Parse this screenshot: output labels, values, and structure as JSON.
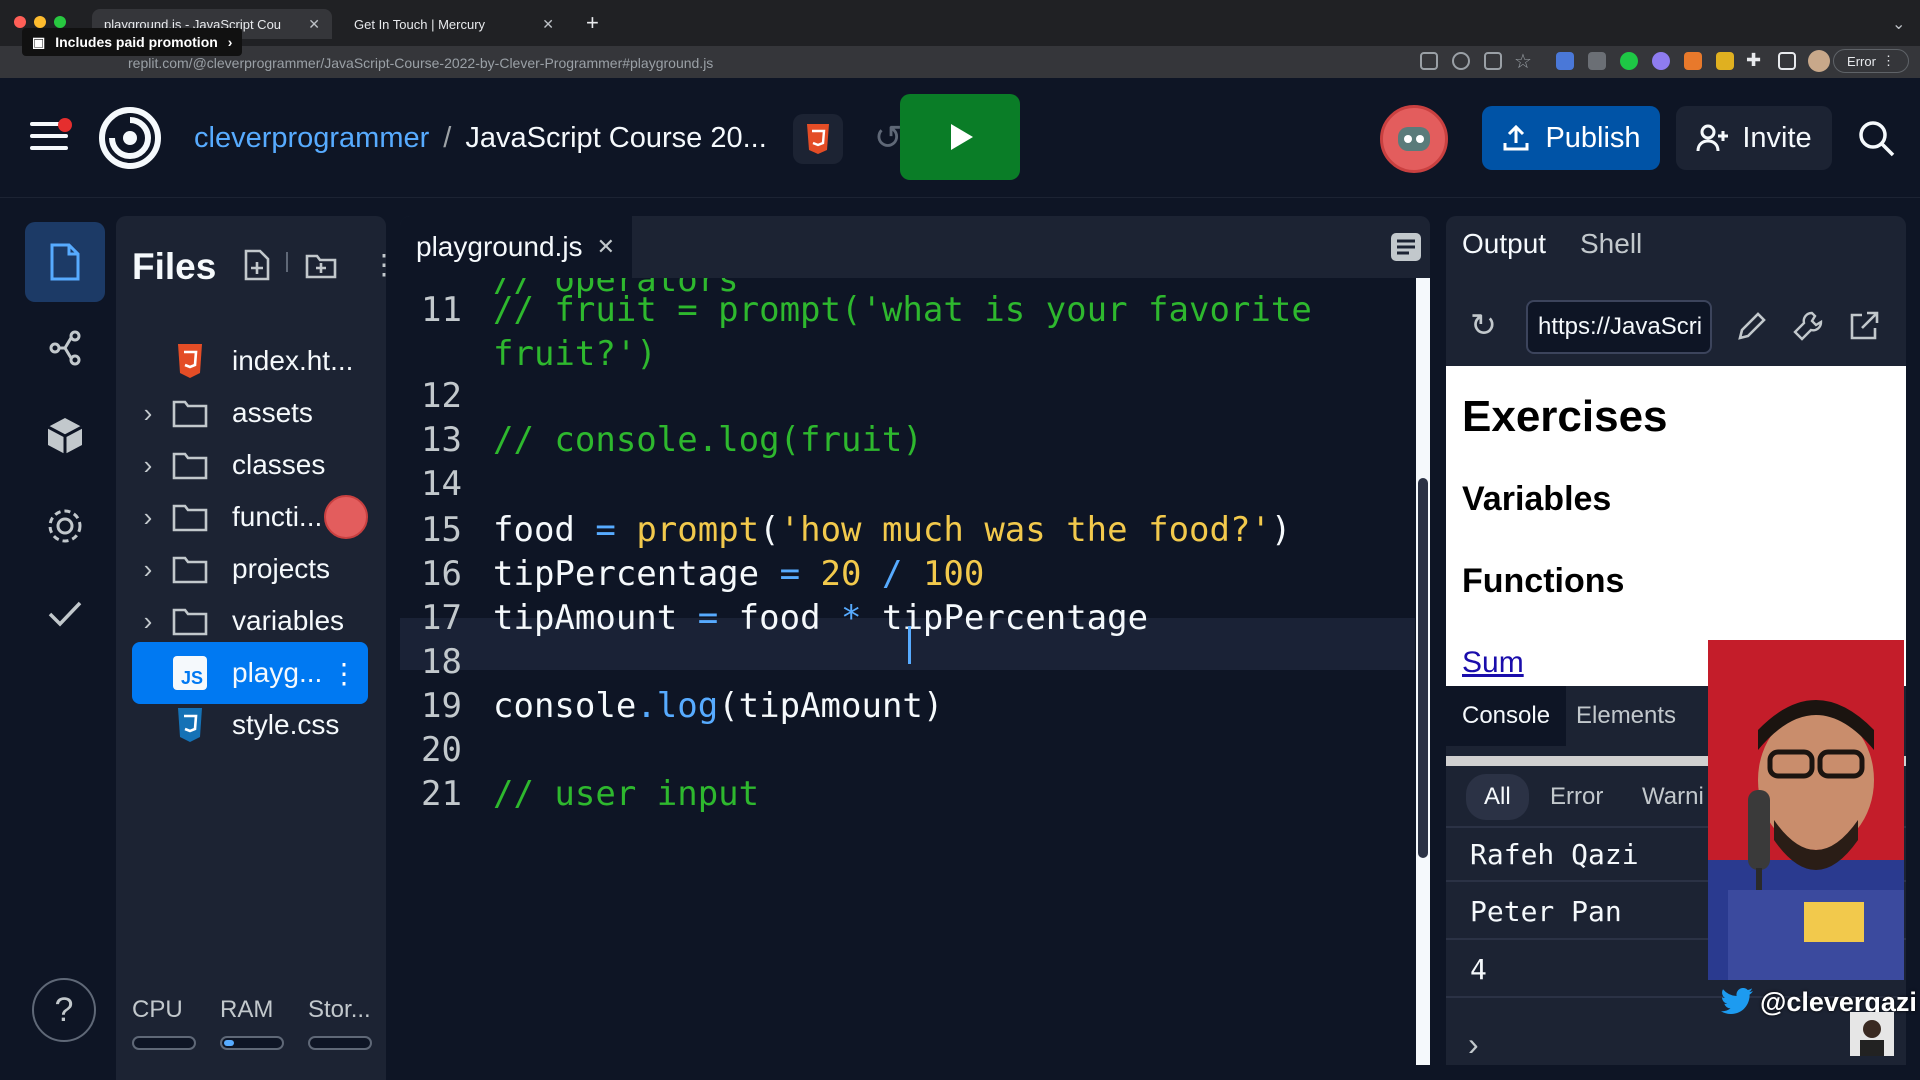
{
  "browser": {
    "tabs": [
      {
        "title": "playground.js - JavaScript Cou",
        "active": true
      },
      {
        "title": "Get In Touch | Mercury",
        "active": false
      }
    ],
    "new_tab": "+",
    "promo": "Includes paid promotion",
    "url": "replit.com/@cleverprogrammer/JavaScript-Course-2022-by-Clever-Programmer#playground.js",
    "error_pill": "Error"
  },
  "header": {
    "owner": "cleverprogrammer",
    "separator": "/",
    "project": "JavaScript Course 20...",
    "publish_label": "Publish",
    "invite_label": "Invite"
  },
  "files": {
    "title": "Files",
    "items": [
      {
        "name": "index.ht...",
        "type": "html",
        "folder": false
      },
      {
        "name": "assets",
        "type": "folder",
        "folder": true
      },
      {
        "name": "classes",
        "type": "folder",
        "folder": true
      },
      {
        "name": "functi...",
        "type": "folder",
        "folder": true
      },
      {
        "name": "projects",
        "type": "folder",
        "folder": true
      },
      {
        "name": "variables",
        "type": "folder",
        "folder": true
      },
      {
        "name": "playg...",
        "type": "js",
        "folder": false,
        "active": true
      },
      {
        "name": "style.css",
        "type": "css",
        "folder": false
      }
    ],
    "resources": {
      "cpu": "CPU",
      "ram": "RAM",
      "storage": "Stor..."
    }
  },
  "editor": {
    "tab": "playground.js",
    "lines": [
      {
        "n": "11",
        "tokens": [
          {
            "t": "// fruit = prompt('what is your favorite",
            "c": "cm"
          }
        ]
      },
      {
        "n": "",
        "tokens": [
          {
            "t": "fruit?')",
            "c": "cm"
          }
        ]
      },
      {
        "n": "12",
        "tokens": []
      },
      {
        "n": "13",
        "tokens": [
          {
            "t": "// console.log(fruit)",
            "c": "cm"
          }
        ]
      },
      {
        "n": "14",
        "tokens": []
      },
      {
        "n": "15",
        "tokens": [
          {
            "t": "food ",
            "c": "id"
          },
          {
            "t": "=",
            "c": "op"
          },
          {
            "t": " ",
            "c": "id"
          },
          {
            "t": "prompt",
            "c": "str"
          },
          {
            "t": "(",
            "c": "id"
          },
          {
            "t": "'how much was the food?'",
            "c": "str"
          },
          {
            "t": ")",
            "c": "id"
          }
        ]
      },
      {
        "n": "16",
        "tokens": [
          {
            "t": "tipPercentage ",
            "c": "id"
          },
          {
            "t": "=",
            "c": "op"
          },
          {
            "t": " ",
            "c": "id"
          },
          {
            "t": "20",
            "c": "num"
          },
          {
            "t": " ",
            "c": "id"
          },
          {
            "t": "/",
            "c": "op"
          },
          {
            "t": " ",
            "c": "id"
          },
          {
            "t": "100",
            "c": "num"
          }
        ]
      },
      {
        "n": "17",
        "tokens": [
          {
            "t": "tipAmount ",
            "c": "id"
          },
          {
            "t": "=",
            "c": "op"
          },
          {
            "t": " food ",
            "c": "id"
          },
          {
            "t": "*",
            "c": "op"
          },
          {
            "t": " tipPercentage",
            "c": "id"
          }
        ]
      },
      {
        "n": "18",
        "tokens": []
      },
      {
        "n": "19",
        "tokens": [
          {
            "t": "console",
            "c": "id"
          },
          {
            "t": ".",
            "c": "op"
          },
          {
            "t": "log",
            "c": "op"
          },
          {
            "t": "(tipAmount)",
            "c": "id"
          }
        ]
      },
      {
        "n": "20",
        "tokens": []
      },
      {
        "n": "21",
        "tokens": [
          {
            "t": "// user input",
            "c": "cm"
          }
        ]
      }
    ]
  },
  "output": {
    "tabs": [
      "Output",
      "Shell"
    ],
    "webview_url": "https://JavaScri",
    "page": {
      "h1": "Exercises",
      "h2": [
        "Variables",
        "Functions"
      ],
      "link": "Sum"
    },
    "devtools": {
      "tabs": [
        "Console",
        "Elements"
      ],
      "filters": [
        "All",
        "Error",
        "Warni"
      ],
      "logs": [
        "Rafeh Qazi",
        "Peter Pan",
        "4"
      ]
    }
  },
  "overlay": {
    "twitter_handle": "@cleverqazi"
  },
  "colors": {
    "accent": "#0079f2",
    "run": "#0a7d27",
    "publish": "#0053a6",
    "comment": "#2eb82e",
    "string": "#f2c94c"
  }
}
